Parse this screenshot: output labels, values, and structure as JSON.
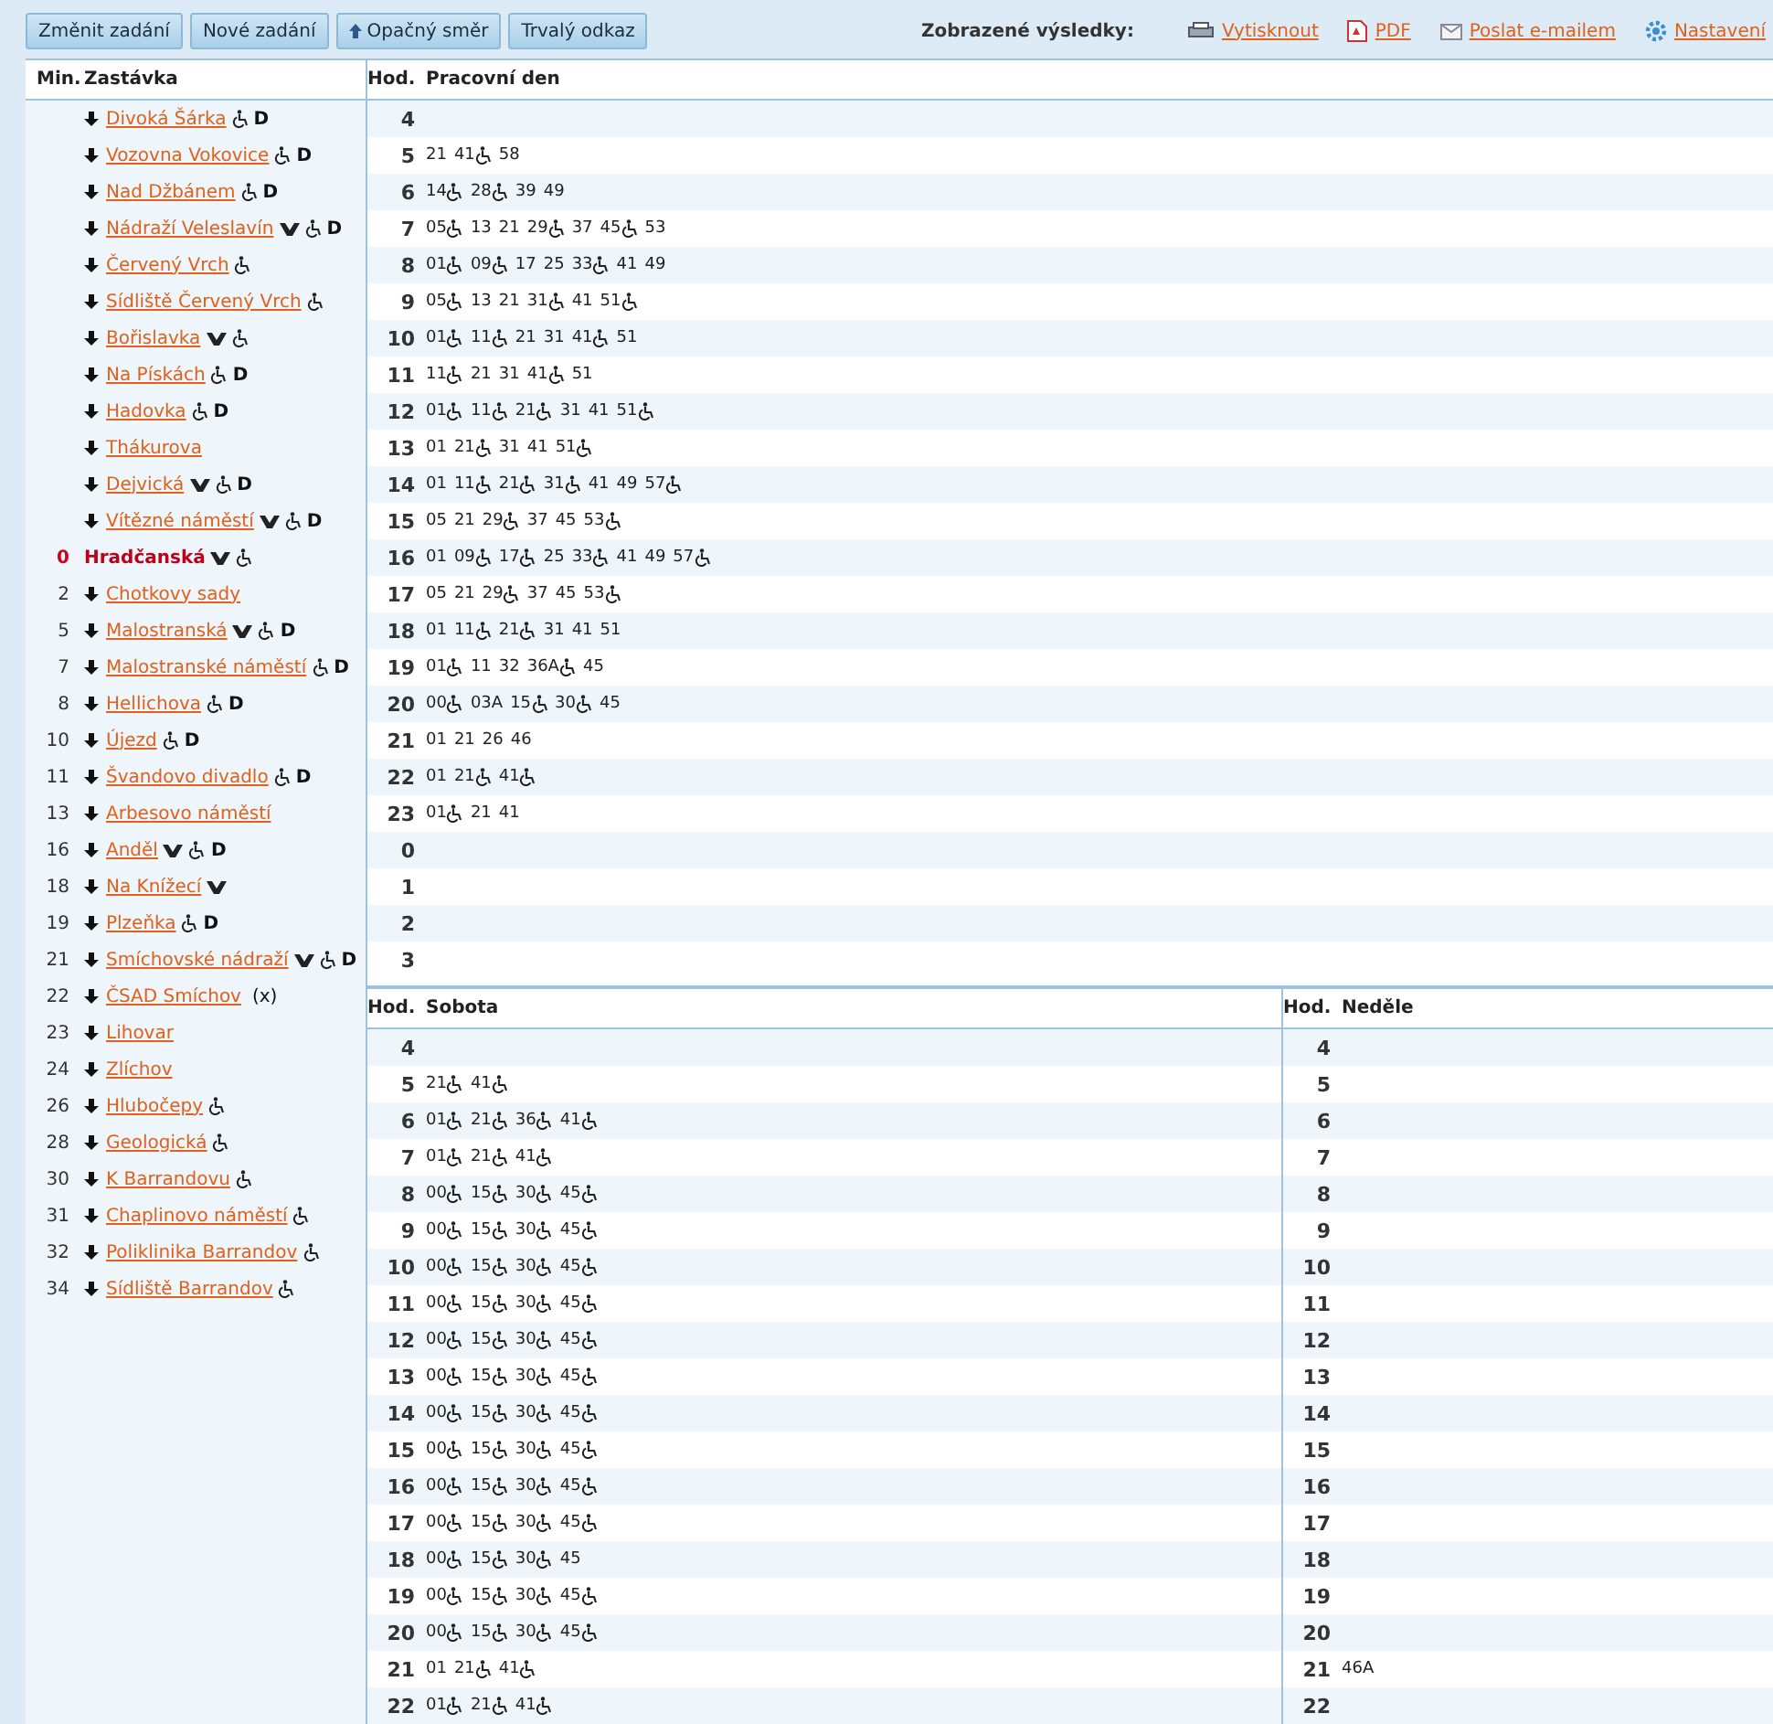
{
  "toolbar": {
    "buttons": [
      {
        "label": "Změnit zadání",
        "icon": false
      },
      {
        "label": "Nové zadání",
        "icon": false
      },
      {
        "label": "Opačný směr",
        "icon": true
      },
      {
        "label": "Trvalý odkaz",
        "icon": false
      }
    ],
    "results_label": "Zobrazené výsledky:",
    "links": [
      {
        "label": "Vytisknout",
        "kind": "print"
      },
      {
        "label": "PDF",
        "kind": "pdf"
      },
      {
        "label": "Poslat e-mailem",
        "kind": "email"
      },
      {
        "label": "Nastavení",
        "kind": "settings"
      }
    ]
  },
  "stops": {
    "columns": [
      "Min.",
      "Zastávka"
    ],
    "items": [
      {
        "name": "Divoká Šárka",
        "current": false,
        "metro": false,
        "accessible": true,
        "note": "D"
      },
      {
        "name": "Vozovna Vokovice",
        "current": false,
        "metro": false,
        "accessible": true,
        "note": "D"
      },
      {
        "name": "Nad Džbánem",
        "current": false,
        "metro": false,
        "accessible": true,
        "note": "D"
      },
      {
        "name": "Nádraží Veleslavín",
        "current": false,
        "metro": true,
        "accessible": true,
        "note": "D"
      },
      {
        "name": "Červený Vrch",
        "current": false,
        "metro": false,
        "accessible": true
      },
      {
        "name": "Sídliště Červený Vrch",
        "current": false,
        "metro": false,
        "accessible": true
      },
      {
        "name": "Bořislavka",
        "current": false,
        "metro": true,
        "accessible": true
      },
      {
        "name": "Na Pískách",
        "current": false,
        "metro": false,
        "accessible": true,
        "note": "D"
      },
      {
        "name": "Hadovka",
        "current": false,
        "metro": false,
        "accessible": true,
        "note": "D"
      },
      {
        "name": "Thákurova",
        "current": false,
        "metro": false,
        "accessible": false
      },
      {
        "name": "Dejvická",
        "current": false,
        "metro": true,
        "accessible": true,
        "note": "D"
      },
      {
        "name": "Vítězné náměstí",
        "current": false,
        "metro": true,
        "accessible": true,
        "note": "D"
      },
      {
        "min": "0",
        "name": "Hradčanská",
        "current": true,
        "metro": true,
        "accessible": true
      },
      {
        "min": "2",
        "name": "Chotkovy sady",
        "current": false,
        "metro": false,
        "accessible": false
      },
      {
        "min": "5",
        "name": "Malostranská",
        "current": false,
        "metro": true,
        "accessible": true,
        "note": "D"
      },
      {
        "min": "7",
        "name": "Malostranské náměstí",
        "current": false,
        "metro": false,
        "accessible": true,
        "note": "D"
      },
      {
        "min": "8",
        "name": "Hellichova",
        "current": false,
        "metro": false,
        "accessible": true,
        "note": "D"
      },
      {
        "min": "10",
        "name": "Újezd",
        "current": false,
        "metro": false,
        "accessible": true,
        "note": "D"
      },
      {
        "min": "11",
        "name": "Švandovo divadlo",
        "current": false,
        "metro": false,
        "accessible": true,
        "note": "D"
      },
      {
        "min": "13",
        "name": "Arbesovo náměstí",
        "current": false,
        "metro": false,
        "accessible": false
      },
      {
        "min": "16",
        "name": "Anděl",
        "current": false,
        "metro": true,
        "accessible": true,
        "note": "D"
      },
      {
        "min": "18",
        "name": "Na Knížecí",
        "current": false,
        "metro": true,
        "accessible": false
      },
      {
        "min": "19",
        "name": "Plzeňka",
        "current": false,
        "metro": false,
        "accessible": true,
        "note": "D"
      },
      {
        "min": "21",
        "name": "Smíchovské nádraží",
        "current": false,
        "metro": true,
        "accessible": true,
        "note": "D"
      },
      {
        "min": "22",
        "name": "ČSAD Smíchov",
        "current": false,
        "metro": false,
        "accessible": false,
        "note": "(x)"
      },
      {
        "min": "23",
        "name": "Lihovar",
        "current": false,
        "metro": false,
        "accessible": false
      },
      {
        "min": "24",
        "name": "Zlíchov",
        "current": false,
        "metro": false,
        "accessible": false
      },
      {
        "min": "26",
        "name": "Hlubočepy",
        "current": false,
        "metro": false,
        "accessible": true
      },
      {
        "min": "28",
        "name": "Geologická",
        "current": false,
        "metro": false,
        "accessible": true
      },
      {
        "min": "30",
        "name": "K Barrandovu",
        "current": false,
        "metro": false,
        "accessible": true
      },
      {
        "min": "31",
        "name": "Chaplinovo náměstí",
        "current": false,
        "metro": false,
        "accessible": true
      },
      {
        "min": "32",
        "name": "Poliklinika Barrandov",
        "current": false,
        "metro": false,
        "accessible": true
      },
      {
        "min": "34",
        "name": "Sídliště Barrandov",
        "current": false,
        "metro": false,
        "accessible": true
      }
    ]
  },
  "weekday": {
    "hour_label": "Hod.",
    "title": "Pracovní den",
    "rows": [
      {
        "hour": "4",
        "departures": []
      },
      {
        "hour": "5",
        "departures": [
          {
            "time": "21",
            "accessible": false
          },
          {
            "time": "41",
            "accessible": true
          },
          {
            "time": "58",
            "accessible": false
          }
        ]
      },
      {
        "hour": "6",
        "departures": [
          {
            "time": "14",
            "accessible": true
          },
          {
            "time": "28",
            "accessible": true
          },
          {
            "time": "39",
            "accessible": false
          },
          {
            "time": "49",
            "accessible": false
          }
        ]
      },
      {
        "hour": "7",
        "departures": [
          {
            "time": "05",
            "accessible": true
          },
          {
            "time": "13",
            "accessible": false
          },
          {
            "time": "21",
            "accessible": false
          },
          {
            "time": "29",
            "accessible": true
          },
          {
            "time": "37",
            "accessible": false
          },
          {
            "time": "45",
            "accessible": true
          },
          {
            "time": "53",
            "accessible": false
          }
        ]
      },
      {
        "hour": "8",
        "departures": [
          {
            "time": "01",
            "accessible": true
          },
          {
            "time": "09",
            "accessible": true
          },
          {
            "time": "17",
            "accessible": false
          },
          {
            "time": "25",
            "accessible": false
          },
          {
            "time": "33",
            "accessible": true
          },
          {
            "time": "41",
            "accessible": false
          },
          {
            "time": "49",
            "accessible": false
          }
        ]
      },
      {
        "hour": "9",
        "departures": [
          {
            "time": "05",
            "accessible": true
          },
          {
            "time": "13",
            "accessible": false
          },
          {
            "time": "21",
            "accessible": false
          },
          {
            "time": "31",
            "accessible": true
          },
          {
            "time": "41",
            "accessible": false
          },
          {
            "time": "51",
            "accessible": true
          }
        ]
      },
      {
        "hour": "10",
        "departures": [
          {
            "time": "01",
            "accessible": true
          },
          {
            "time": "11",
            "accessible": true
          },
          {
            "time": "21",
            "accessible": false
          },
          {
            "time": "31",
            "accessible": false
          },
          {
            "time": "41",
            "accessible": true
          },
          {
            "time": "51",
            "accessible": false
          }
        ]
      },
      {
        "hour": "11",
        "departures": [
          {
            "time": "11",
            "accessible": true
          },
          {
            "time": "21",
            "accessible": false
          },
          {
            "time": "31",
            "accessible": false
          },
          {
            "time": "41",
            "accessible": true
          },
          {
            "time": "51",
            "accessible": false
          }
        ]
      },
      {
        "hour": "12",
        "departures": [
          {
            "time": "01",
            "accessible": true
          },
          {
            "time": "11",
            "accessible": true
          },
          {
            "time": "21",
            "accessible": true
          },
          {
            "time": "31",
            "accessible": false
          },
          {
            "time": "41",
            "accessible": false
          },
          {
            "time": "51",
            "accessible": true
          }
        ]
      },
      {
        "hour": "13",
        "departures": [
          {
            "time": "01",
            "accessible": false
          },
          {
            "time": "21",
            "accessible": true
          },
          {
            "time": "31",
            "accessible": false
          },
          {
            "time": "41",
            "accessible": false
          },
          {
            "time": "51",
            "accessible": true
          }
        ]
      },
      {
        "hour": "14",
        "departures": [
          {
            "time": "01",
            "accessible": false
          },
          {
            "time": "11",
            "accessible": true
          },
          {
            "time": "21",
            "accessible": true
          },
          {
            "time": "31",
            "accessible": true
          },
          {
            "time": "41",
            "accessible": false
          },
          {
            "time": "49",
            "accessible": false
          },
          {
            "time": "57",
            "accessible": true
          }
        ]
      },
      {
        "hour": "15",
        "departures": [
          {
            "time": "05",
            "accessible": false
          },
          {
            "time": "21",
            "accessible": false
          },
          {
            "time": "29",
            "accessible": true
          },
          {
            "time": "37",
            "accessible": false
          },
          {
            "time": "45",
            "accessible": false
          },
          {
            "time": "53",
            "accessible": true
          }
        ]
      },
      {
        "hour": "16",
        "departures": [
          {
            "time": "01",
            "accessible": false
          },
          {
            "time": "09",
            "accessible": true
          },
          {
            "time": "17",
            "accessible": true
          },
          {
            "time": "25",
            "accessible": false
          },
          {
            "time": "33",
            "accessible": true
          },
          {
            "time": "41",
            "accessible": false
          },
          {
            "time": "49",
            "accessible": false
          },
          {
            "time": "57",
            "accessible": true
          }
        ]
      },
      {
        "hour": "17",
        "departures": [
          {
            "time": "05",
            "accessible": false
          },
          {
            "time": "21",
            "accessible": false
          },
          {
            "time": "29",
            "accessible": true
          },
          {
            "time": "37",
            "accessible": false
          },
          {
            "time": "45",
            "accessible": false
          },
          {
            "time": "53",
            "accessible": true
          }
        ]
      },
      {
        "hour": "18",
        "departures": [
          {
            "time": "01",
            "accessible": false
          },
          {
            "time": "11",
            "accessible": true
          },
          {
            "time": "21",
            "accessible": true
          },
          {
            "time": "31",
            "accessible": false
          },
          {
            "time": "41",
            "accessible": false
          },
          {
            "time": "51",
            "accessible": false
          }
        ]
      },
      {
        "hour": "19",
        "departures": [
          {
            "time": "01",
            "accessible": true
          },
          {
            "time": "11",
            "accessible": false
          },
          {
            "time": "32",
            "accessible": false
          },
          {
            "time": "36A",
            "accessible": true
          },
          {
            "time": "45",
            "accessible": false
          }
        ]
      },
      {
        "hour": "20",
        "departures": [
          {
            "time": "00",
            "accessible": true
          },
          {
            "time": "03A",
            "accessible": false
          },
          {
            "time": "15",
            "accessible": true
          },
          {
            "time": "30",
            "accessible": true
          },
          {
            "time": "45",
            "accessible": false
          }
        ]
      },
      {
        "hour": "21",
        "departures": [
          {
            "time": "01",
            "accessible": false
          },
          {
            "time": "21",
            "accessible": false
          },
          {
            "time": "26",
            "accessible": false
          },
          {
            "time": "46",
            "accessible": false
          }
        ]
      },
      {
        "hour": "22",
        "departures": [
          {
            "time": "01",
            "accessible": false
          },
          {
            "time": "21",
            "accessible": true
          },
          {
            "time": "41",
            "accessible": true
          }
        ]
      },
      {
        "hour": "23",
        "departures": [
          {
            "time": "01",
            "accessible": true
          },
          {
            "time": "21",
            "accessible": false
          },
          {
            "time": "41",
            "accessible": false
          }
        ]
      },
      {
        "hour": "0",
        "departures": []
      },
      {
        "hour": "1",
        "departures": []
      },
      {
        "hour": "2",
        "departures": []
      },
      {
        "hour": "3",
        "departures": []
      }
    ]
  },
  "saturday": {
    "hour_label": "Hod.",
    "title": "Sobota",
    "rows": [
      {
        "hour": "4",
        "departures": []
      },
      {
        "hour": "5",
        "departures": [
          {
            "time": "21",
            "accessible": true
          },
          {
            "time": "41",
            "accessible": true
          }
        ]
      },
      {
        "hour": "6",
        "departures": [
          {
            "time": "01",
            "accessible": true
          },
          {
            "time": "21",
            "accessible": true
          },
          {
            "time": "36",
            "accessible": true
          },
          {
            "time": "41",
            "accessible": true
          }
        ]
      },
      {
        "hour": "7",
        "departures": [
          {
            "time": "01",
            "accessible": true
          },
          {
            "time": "21",
            "accessible": true
          },
          {
            "time": "41",
            "accessible": true
          }
        ]
      },
      {
        "hour": "8",
        "departures": [
          {
            "time": "00",
            "accessible": true
          },
          {
            "time": "15",
            "accessible": true
          },
          {
            "time": "30",
            "accessible": true
          },
          {
            "time": "45",
            "accessible": true
          }
        ]
      },
      {
        "hour": "9",
        "departures": [
          {
            "time": "00",
            "accessible": true
          },
          {
            "time": "15",
            "accessible": true
          },
          {
            "time": "30",
            "accessible": true
          },
          {
            "time": "45",
            "accessible": true
          }
        ]
      },
      {
        "hour": "10",
        "departures": [
          {
            "time": "00",
            "accessible": true
          },
          {
            "time": "15",
            "accessible": true
          },
          {
            "time": "30",
            "accessible": true
          },
          {
            "time": "45",
            "accessible": true
          }
        ]
      },
      {
        "hour": "11",
        "departures": [
          {
            "time": "00",
            "accessible": true
          },
          {
            "time": "15",
            "accessible": true
          },
          {
            "time": "30",
            "accessible": true
          },
          {
            "time": "45",
            "accessible": true
          }
        ]
      },
      {
        "hour": "12",
        "departures": [
          {
            "time": "00",
            "accessible": true
          },
          {
            "time": "15",
            "accessible": true
          },
          {
            "time": "30",
            "accessible": true
          },
          {
            "time": "45",
            "accessible": true
          }
        ]
      },
      {
        "hour": "13",
        "departures": [
          {
            "time": "00",
            "accessible": true
          },
          {
            "time": "15",
            "accessible": true
          },
          {
            "time": "30",
            "accessible": true
          },
          {
            "time": "45",
            "accessible": true
          }
        ]
      },
      {
        "hour": "14",
        "departures": [
          {
            "time": "00",
            "accessible": true
          },
          {
            "time": "15",
            "accessible": true
          },
          {
            "time": "30",
            "accessible": true
          },
          {
            "time": "45",
            "accessible": true
          }
        ]
      },
      {
        "hour": "15",
        "departures": [
          {
            "time": "00",
            "accessible": true
          },
          {
            "time": "15",
            "accessible": true
          },
          {
            "time": "30",
            "accessible": true
          },
          {
            "time": "45",
            "accessible": true
          }
        ]
      },
      {
        "hour": "16",
        "departures": [
          {
            "time": "00",
            "accessible": true
          },
          {
            "time": "15",
            "accessible": true
          },
          {
            "time": "30",
            "accessible": true
          },
          {
            "time": "45",
            "accessible": true
          }
        ]
      },
      {
        "hour": "17",
        "departures": [
          {
            "time": "00",
            "accessible": true
          },
          {
            "time": "15",
            "accessible": true
          },
          {
            "time": "30",
            "accessible": true
          },
          {
            "time": "45",
            "accessible": true
          }
        ]
      },
      {
        "hour": "18",
        "departures": [
          {
            "time": "00",
            "accessible": true
          },
          {
            "time": "15",
            "accessible": true
          },
          {
            "time": "30",
            "accessible": true
          },
          {
            "time": "45",
            "accessible": false
          }
        ]
      },
      {
        "hour": "19",
        "departures": [
          {
            "time": "00",
            "accessible": true
          },
          {
            "time": "15",
            "accessible": true
          },
          {
            "time": "30",
            "accessible": true
          },
          {
            "time": "45",
            "accessible": true
          }
        ]
      },
      {
        "hour": "20",
        "departures": [
          {
            "time": "00",
            "accessible": true
          },
          {
            "time": "15",
            "accessible": true
          },
          {
            "time": "30",
            "accessible": true
          },
          {
            "time": "45",
            "accessible": true
          }
        ]
      },
      {
        "hour": "21",
        "departures": [
          {
            "time": "01",
            "accessible": false
          },
          {
            "time": "21",
            "accessible": true
          },
          {
            "time": "41",
            "accessible": true
          }
        ]
      },
      {
        "hour": "22",
        "departures": [
          {
            "time": "01",
            "accessible": true
          },
          {
            "time": "21",
            "accessible": true
          },
          {
            "time": "41",
            "accessible": true
          }
        ]
      }
    ]
  },
  "sunday": {
    "hour_label": "Hod.",
    "title": "Neděle",
    "rows": [
      {
        "hour": "4",
        "departures": []
      },
      {
        "hour": "5",
        "departures": []
      },
      {
        "hour": "6",
        "departures": []
      },
      {
        "hour": "7",
        "departures": []
      },
      {
        "hour": "8",
        "departures": []
      },
      {
        "hour": "9",
        "departures": []
      },
      {
        "hour": "10",
        "departures": []
      },
      {
        "hour": "11",
        "departures": []
      },
      {
        "hour": "12",
        "departures": []
      },
      {
        "hour": "13",
        "departures": []
      },
      {
        "hour": "14",
        "departures": []
      },
      {
        "hour": "15",
        "departures": []
      },
      {
        "hour": "16",
        "departures": []
      },
      {
        "hour": "17",
        "departures": []
      },
      {
        "hour": "18",
        "departures": []
      },
      {
        "hour": "19",
        "departures": []
      },
      {
        "hour": "20",
        "departures": []
      },
      {
        "hour": "21",
        "departures": [
          {
            "time": "46A",
            "accessible": false
          }
        ]
      },
      {
        "hour": "22",
        "departures": []
      }
    ]
  }
}
